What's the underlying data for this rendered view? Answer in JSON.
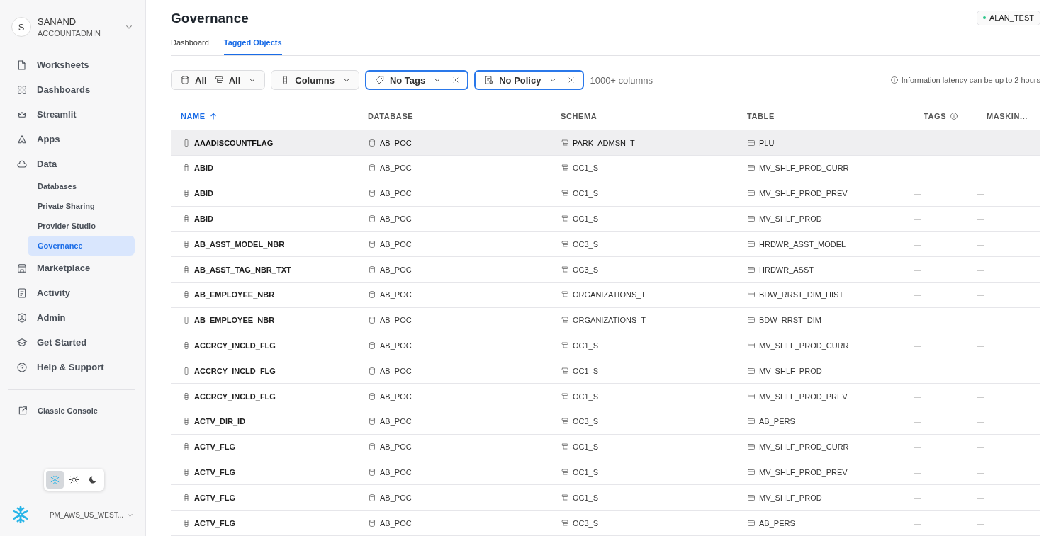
{
  "account": {
    "initial": "S",
    "name": "SANAND",
    "role": "ACCOUNTADMIN"
  },
  "sidebar": {
    "items": [
      {
        "label": "Worksheets",
        "kind": "file",
        "selected": false
      },
      {
        "label": "Dashboards",
        "kind": "grid",
        "selected": false
      },
      {
        "label": "Streamlit",
        "kind": "crown",
        "selected": false
      },
      {
        "label": "Apps",
        "kind": "apps",
        "selected": false
      },
      {
        "label": "Data",
        "kind": "cloud",
        "selected": false,
        "children": [
          {
            "label": "Databases",
            "selected": false
          },
          {
            "label": "Private Sharing",
            "selected": false
          },
          {
            "label": "Provider Studio",
            "selected": false
          },
          {
            "label": "Governance",
            "selected": true
          }
        ]
      },
      {
        "label": "Marketplace",
        "kind": "store",
        "selected": false
      },
      {
        "label": "Activity",
        "kind": "activity",
        "selected": false
      },
      {
        "label": "Admin",
        "kind": "shield",
        "selected": false
      },
      {
        "label": "Get Started",
        "kind": "cap",
        "selected": false
      },
      {
        "label": "Help & Support",
        "kind": "help",
        "selected": false
      }
    ],
    "footer_link": "Classic Console",
    "theme_options": [
      {
        "kind": "snowflake",
        "selected": true
      },
      {
        "kind": "sun",
        "selected": false
      },
      {
        "kind": "moon",
        "selected": false
      }
    ],
    "region": "PM_AWS_US_WEST..."
  },
  "page": {
    "title": "Governance",
    "warehouse": {
      "label": "ALAN_TEST",
      "color": "#2bc48a"
    },
    "tabs": [
      {
        "label": "Dashboard",
        "selected": false
      },
      {
        "label": "Tagged Objects",
        "selected": true
      }
    ]
  },
  "filters": [
    {
      "parts": [
        {
          "kind": "database",
          "label": "All"
        },
        {
          "kind": "schema",
          "label": "All"
        }
      ],
      "active": false,
      "removable": false
    },
    {
      "parts": [
        {
          "kind": "column",
          "label": "Columns"
        }
      ],
      "active": false,
      "removable": false
    },
    {
      "parts": [
        {
          "kind": "tag",
          "label": "No Tags"
        }
      ],
      "active": true,
      "removable": true
    },
    {
      "parts": [
        {
          "kind": "policy",
          "label": "No Policy"
        }
      ],
      "active": true,
      "removable": true
    }
  ],
  "result_count": "1000+ columns",
  "latency_note": "Information latency can be up to 2 hours",
  "table": {
    "columns": [
      {
        "label": "NAME",
        "sorted": true,
        "info": false
      },
      {
        "label": "DATABASE",
        "sorted": false,
        "info": false
      },
      {
        "label": "SCHEMA",
        "sorted": false,
        "info": false
      },
      {
        "label": "TABLE",
        "sorted": false,
        "info": false
      },
      {
        "label": "TAGS",
        "sorted": false,
        "info": true
      },
      {
        "label": "MASKIN...",
        "sorted": false,
        "info": false
      }
    ],
    "rows": [
      {
        "name": "AAADISCOUNTFLAG",
        "database": "AB_POC",
        "schema": "PARK_ADMSN_T",
        "table": "PLU",
        "tags": "—",
        "masking": "—",
        "selected": true
      },
      {
        "name": "ABID",
        "database": "AB_POC",
        "schema": "OC1_S",
        "table": "MV_SHLF_PROD_CURR",
        "tags": "—",
        "masking": "—",
        "selected": false
      },
      {
        "name": "ABID",
        "database": "AB_POC",
        "schema": "OC1_S",
        "table": "MV_SHLF_PROD_PREV",
        "tags": "—",
        "masking": "—",
        "selected": false
      },
      {
        "name": "ABID",
        "database": "AB_POC",
        "schema": "OC1_S",
        "table": "MV_SHLF_PROD",
        "tags": "—",
        "masking": "—",
        "selected": false
      },
      {
        "name": "AB_ASST_MODEL_NBR",
        "database": "AB_POC",
        "schema": "OC3_S",
        "table": "HRDWR_ASST_MODEL",
        "tags": "—",
        "masking": "—",
        "selected": false
      },
      {
        "name": "AB_ASST_TAG_NBR_TXT",
        "database": "AB_POC",
        "schema": "OC3_S",
        "table": "HRDWR_ASST",
        "tags": "—",
        "masking": "—",
        "selected": false
      },
      {
        "name": "AB_EMPLOYEE_NBR",
        "database": "AB_POC",
        "schema": "ORGANIZATIONS_T",
        "table": "BDW_RRST_DIM_HIST",
        "tags": "—",
        "masking": "—",
        "selected": false
      },
      {
        "name": "AB_EMPLOYEE_NBR",
        "database": "AB_POC",
        "schema": "ORGANIZATIONS_T",
        "table": "BDW_RRST_DIM",
        "tags": "—",
        "masking": "—",
        "selected": false
      },
      {
        "name": "ACCRCY_INCLD_FLG",
        "database": "AB_POC",
        "schema": "OC1_S",
        "table": "MV_SHLF_PROD_CURR",
        "tags": "—",
        "masking": "—",
        "selected": false
      },
      {
        "name": "ACCRCY_INCLD_FLG",
        "database": "AB_POC",
        "schema": "OC1_S",
        "table": "MV_SHLF_PROD",
        "tags": "—",
        "masking": "—",
        "selected": false
      },
      {
        "name": "ACCRCY_INCLD_FLG",
        "database": "AB_POC",
        "schema": "OC1_S",
        "table": "MV_SHLF_PROD_PREV",
        "tags": "—",
        "masking": "—",
        "selected": false
      },
      {
        "name": "ACTV_DIR_ID",
        "database": "AB_POC",
        "schema": "OC3_S",
        "table": "AB_PERS",
        "tags": "—",
        "masking": "—",
        "selected": false
      },
      {
        "name": "ACTV_FLG",
        "database": "AB_POC",
        "schema": "OC1_S",
        "table": "MV_SHLF_PROD_CURR",
        "tags": "—",
        "masking": "—",
        "selected": false
      },
      {
        "name": "ACTV_FLG",
        "database": "AB_POC",
        "schema": "OC1_S",
        "table": "MV_SHLF_PROD_PREV",
        "tags": "—",
        "masking": "—",
        "selected": false
      },
      {
        "name": "ACTV_FLG",
        "database": "AB_POC",
        "schema": "OC1_S",
        "table": "MV_SHLF_PROD",
        "tags": "—",
        "masking": "—",
        "selected": false
      },
      {
        "name": "ACTV_FLG",
        "database": "AB_POC",
        "schema": "OC3_S",
        "table": "AB_PERS",
        "tags": "—",
        "masking": "—",
        "selected": false
      }
    ]
  }
}
